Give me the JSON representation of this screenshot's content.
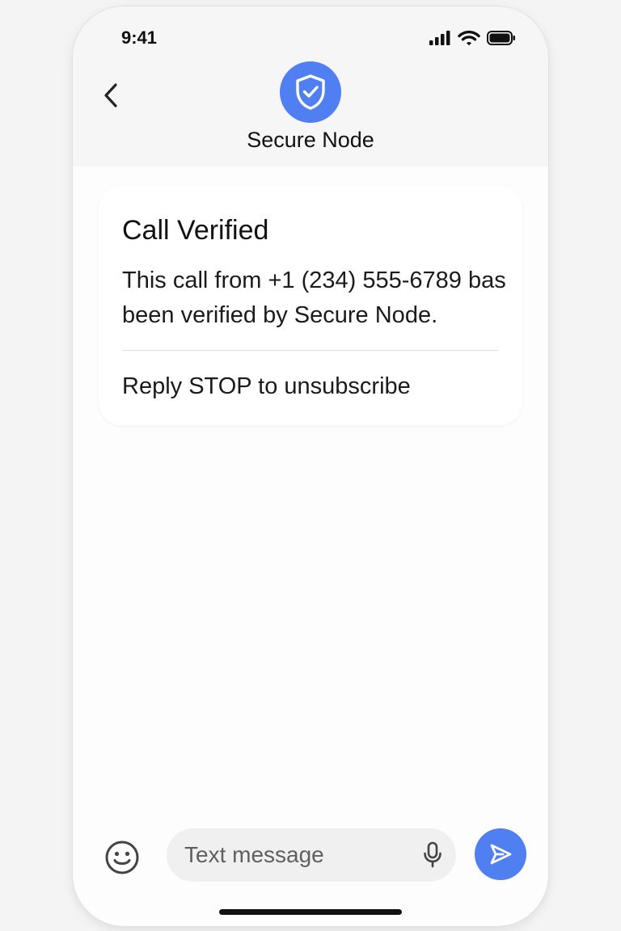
{
  "status_bar": {
    "time": "9:41",
    "icons": [
      "signal-icon",
      "wifi-icon",
      "battery-icon"
    ]
  },
  "header": {
    "back_icon": "chevron-left-icon",
    "avatar_icon": "shield-check-icon",
    "contact_name": "Secure Node"
  },
  "message": {
    "title": "Call Verified",
    "body": "This call from +1 (234) 555-6789 bas been verified by Secure Node.",
    "footer": "Reply STOP to unsubscribe"
  },
  "composer": {
    "emoji_icon": "emoji-icon",
    "placeholder": "Text message",
    "mic_icon": "microphone-icon",
    "send_icon": "send-icon"
  },
  "colors": {
    "accent": "#4f7ff0",
    "background": "#fdfdfd",
    "header_background": "#f6f6f6",
    "text": "#111111"
  }
}
